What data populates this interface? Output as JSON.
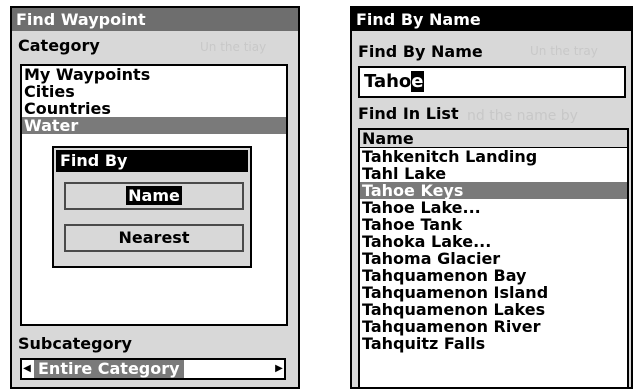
{
  "left": {
    "title": "Find Waypoint",
    "category_label": "Category",
    "categories": [
      "My Waypoints",
      "Cities",
      "Countries",
      "Water"
    ],
    "find_by": {
      "title": "Find By",
      "name_button": "Name",
      "nearest_button": "Nearest"
    },
    "subcategory_label": "Subcategory",
    "subcategory_value": "Entire Category"
  },
  "right": {
    "title": "Find By Name",
    "field_label": "Find By Name",
    "name_value_before": "Taho",
    "name_value_cursor": "e",
    "list_label": "Find In List",
    "list_header": "Name",
    "results": [
      "Tahkenitch Landing",
      "Tahl Lake",
      "Tahoe Keys",
      "Tahoe Lake...",
      "Tahoe Tank",
      "Tahoka Lake...",
      "Tahoma Glacier",
      "Tahquamenon Bay",
      "Tahquamenon Island",
      "Tahquamenon Lakes",
      "Tahquamenon River",
      "Tahquitz Falls"
    ]
  }
}
